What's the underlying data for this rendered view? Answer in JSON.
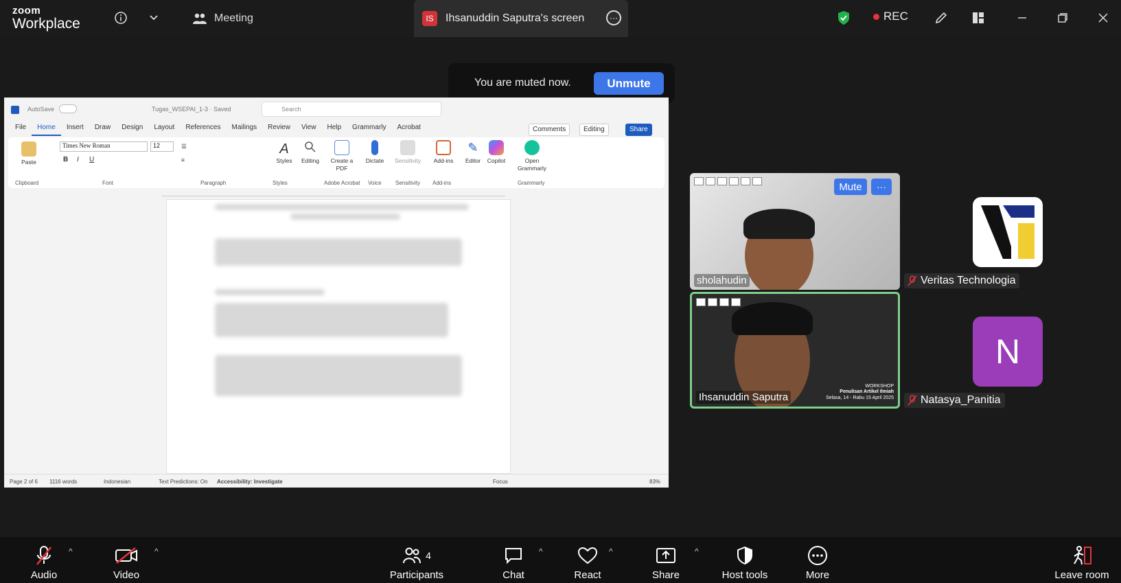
{
  "app": {
    "brand_line1": "zoom",
    "brand_line2": "Workplace"
  },
  "topbar": {
    "meeting_label": "Meeting",
    "screen_badge": "IS",
    "screen_title": "Ihsanuddin Saputra's screen",
    "rec_label": "REC"
  },
  "muted_banner": {
    "text": "You are muted now.",
    "unmute_label": "Unmute"
  },
  "word": {
    "autosave": "AutoSave",
    "doc_title": "Tugas_WSEPAI_1-3 · Saved",
    "search_placeholder": "Search",
    "tabs": [
      "File",
      "Home",
      "Insert",
      "Draw",
      "Design",
      "Layout",
      "References",
      "Mailings",
      "Review",
      "View",
      "Help",
      "Grammarly",
      "Acrobat"
    ],
    "active_tab": "Home",
    "comments_label": "Comments",
    "editing_label": "Editing",
    "share_label": "Share",
    "font_name": "Times New Roman",
    "font_size": "12",
    "groups": {
      "clipboard": "Clipboard",
      "font": "Font",
      "paragraph": "Paragraph",
      "styles": "Styles",
      "adobe": "Adobe Acrobat",
      "voice": "Voice",
      "sensitivity": "Sensitivity",
      "addins": "Add-ins",
      "grammarly": "Grammarly"
    },
    "buttons": {
      "paste": "Paste",
      "styles": "Styles",
      "editing": "Editing",
      "create_pdf": "Create a PDF",
      "dictate": "Dictate",
      "sensitivity": "Sensitivity",
      "addins": "Add-ins",
      "editor": "Editor",
      "copilot": "Copilot",
      "open_grammarly": "Open Grammarly"
    },
    "status": {
      "page": "Page 2 of 6",
      "words": "1116 words",
      "language": "Indonesian",
      "predictions": "Text Predictions: On",
      "accessibility": "Accessibility: Investigate",
      "focus": "Focus",
      "zoom": "83%"
    }
  },
  "participants": {
    "tile1": {
      "name": "sholahudin",
      "mute_label": "Mute"
    },
    "tile2": {
      "name": "Ihsanuddin Saputra",
      "banner_line1": "WORKSHOP",
      "banner_line2": "Penulisan Artikel Ilmiah",
      "banner_line3": "Selasa, 14 - Rabu 15 April 2025"
    },
    "side1": {
      "name": "Veritas Technologia"
    },
    "side2": {
      "name": "Natasya_Panitia",
      "initial": "N"
    }
  },
  "bottombar": {
    "audio": "Audio",
    "video": "Video",
    "participants": "Participants",
    "participants_count": "4",
    "chat": "Chat",
    "react": "React",
    "share": "Share",
    "host_tools": "Host tools",
    "more": "More",
    "leave": "Leave room"
  },
  "colors": {
    "accent": "#3d76e8",
    "rec": "#e5343d",
    "speaker_border": "#7ed08a",
    "avatar_n": "#9b3db8",
    "word_blue": "#1e5bbf"
  }
}
